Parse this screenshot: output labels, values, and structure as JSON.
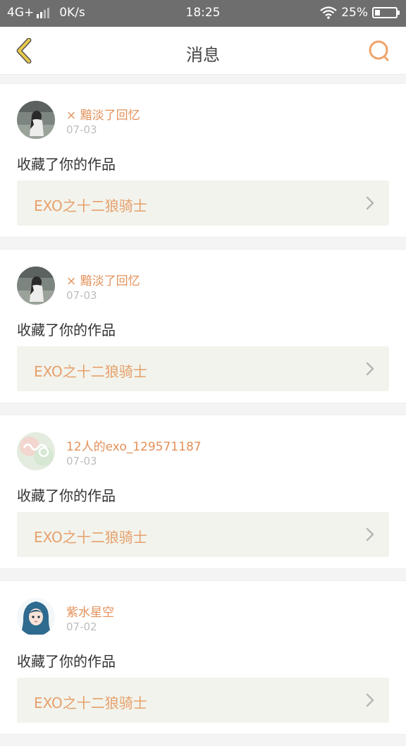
{
  "status_bar": {
    "network": "4G+",
    "speed": "0K/s",
    "time": "18:25",
    "battery": "25%",
    "battery_level": 0.25
  },
  "header": {
    "title": "消息",
    "back_icon": "chevron-left-icon",
    "search_icon": "search-icon"
  },
  "colors": {
    "accent": "#e3905a",
    "back_icon": "#e8c94a",
    "card_link_bg": "#f2f3ec"
  },
  "messages": [
    {
      "username": "× 黯淡了回忆",
      "date": "07-03",
      "action": "收藏了你的作品",
      "work_title": "EXO之十二狼骑士",
      "avatar": "girl-by-lake"
    },
    {
      "username": "× 黯淡了回忆",
      "date": "07-03",
      "action": "收藏了你的作品",
      "work_title": "EXO之十二狼骑士",
      "avatar": "girl-by-lake"
    },
    {
      "username": "12人的exo_129571187",
      "date": "07-03",
      "action": "收藏了你的作品",
      "work_title": "EXO之十二狼骑士",
      "avatar": "exo-logo"
    },
    {
      "username": "紫水星空",
      "date": "07-02",
      "action": "收藏了你的作品",
      "work_title": "EXO之十二狼骑士",
      "avatar": "blue-hair-illustration"
    }
  ]
}
